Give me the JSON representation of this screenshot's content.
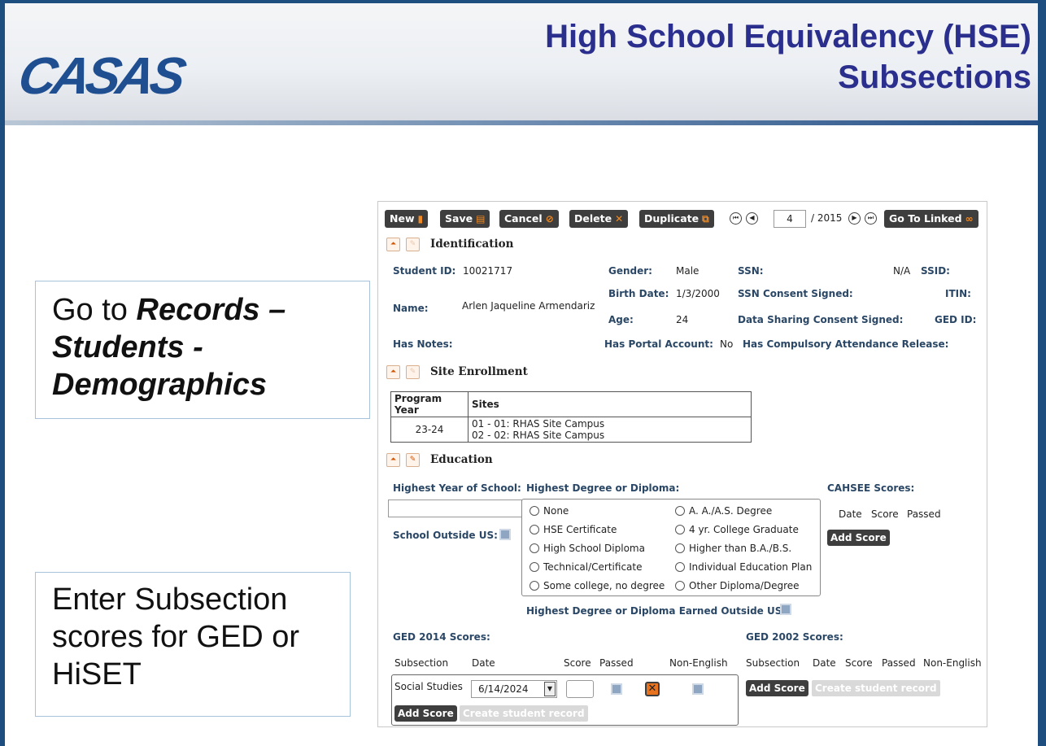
{
  "slide": {
    "logo": "CASAS",
    "title_line1": "High School Equivalency (HSE)",
    "title_line2": "Subsections",
    "callout1": {
      "prefix": "Go to ",
      "em1": "Records –",
      "em2": "Students -",
      "em3": "Demographics"
    },
    "callout2": {
      "line1": "Enter Subsection",
      "line2": "scores for GED or",
      "line3": "HiSET"
    }
  },
  "toolbar": {
    "new": "New",
    "save": "Save",
    "cancel": "Cancel",
    "delete": "Delete",
    "duplicate": "Duplicate",
    "record_current": "4",
    "record_total": "/ 2015",
    "go_linked": "Go To Linked"
  },
  "identification": {
    "title": "Identification",
    "student_id_label": "Student ID:",
    "student_id": "10021717",
    "gender_label": "Gender:",
    "gender": "Male",
    "ssn_label": "SSN:",
    "ssn": "N/A",
    "ssid_label": "SSID:",
    "birth_label": "Birth Date:",
    "birth": "1/3/2000",
    "ssn_consent_label": "SSN Consent Signed:",
    "itin_label": "ITIN:",
    "name_label": "Name:",
    "name": "Arlen Jaqueline Armendariz",
    "age_label": "Age:",
    "age": "24",
    "data_sharing_label": "Data Sharing Consent Signed:",
    "ged_id_label": "GED ID:",
    "has_notes_label": "Has Notes:",
    "portal_label": "Has Portal Account:",
    "portal": "No",
    "compulsory_label": "Has Compulsory Attendance Release:"
  },
  "site_enrollment": {
    "title": "Site Enrollment",
    "headers": [
      "Program Year",
      "Sites"
    ],
    "program_year": "23-24",
    "sites": [
      "01 - 01: RHAS Site Campus",
      "02 - 02: RHAS Site Campus"
    ]
  },
  "education": {
    "title": "Education",
    "highest_year_label": "Highest Year of School:",
    "highest_degree_label": "Highest Degree or Diploma:",
    "cahsee_label": "CAHSEE Scores:",
    "cahsee_cols": [
      "Date",
      "Score",
      "Passed"
    ],
    "add_score": "Add Score",
    "school_outside_label": "School Outside US:",
    "degree_options_left": [
      "None",
      "HSE Certificate",
      "High School Diploma",
      "Technical/Certificate",
      "Some college, no degree"
    ],
    "degree_options_right": [
      "A. A./A.S. Degree",
      "4 yr. College Graduate",
      "Higher than B.A./B.S.",
      "Individual Education Plan",
      "Other Diploma/Degree"
    ],
    "degree_outside_label": "Highest Degree or Diploma Earned Outside US:"
  },
  "ged2014": {
    "title": "GED 2014 Scores:",
    "cols": [
      "Subsection",
      "Date",
      "Score",
      "Passed",
      "Non-English"
    ],
    "row_subsection": "Social Studies",
    "row_date": "6/14/2024",
    "add_score": "Add Score",
    "create_record": "Create student record"
  },
  "ged2002": {
    "title": "GED 2002 Scores:",
    "cols": [
      "Subsection",
      "Date",
      "Score",
      "Passed",
      "Non-English"
    ],
    "add_score": "Add Score",
    "create_record": "Create student record"
  },
  "colors": {
    "title": "#2a2e8c",
    "frame": "#1e4d80",
    "toolbar_btn": "#3e3e3e",
    "accent_icon": "#f08a24"
  }
}
